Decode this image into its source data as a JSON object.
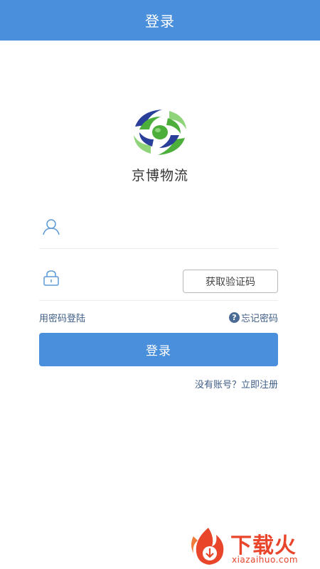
{
  "header": {
    "title": "登录"
  },
  "app": {
    "name": "京博物流"
  },
  "form": {
    "username": {
      "icon": "user-icon",
      "value": "",
      "placeholder": ""
    },
    "code": {
      "icon": "lock-icon",
      "value": "",
      "placeholder": "",
      "button_label": "获取验证码"
    }
  },
  "links": {
    "password_login": "用密码登陆",
    "forgot_password": "忘记密码",
    "forgot_icon": "?"
  },
  "login_button": {
    "label": "登录"
  },
  "register": {
    "text": "没有账号？立即注册"
  },
  "watermark": {
    "brand": "下载火",
    "site": "xiazaihuo.com"
  },
  "colors": {
    "primary": "#4a8fdb",
    "link": "#3f5e86",
    "icon": "#5b9ad6",
    "watermark": "#e8452b"
  }
}
